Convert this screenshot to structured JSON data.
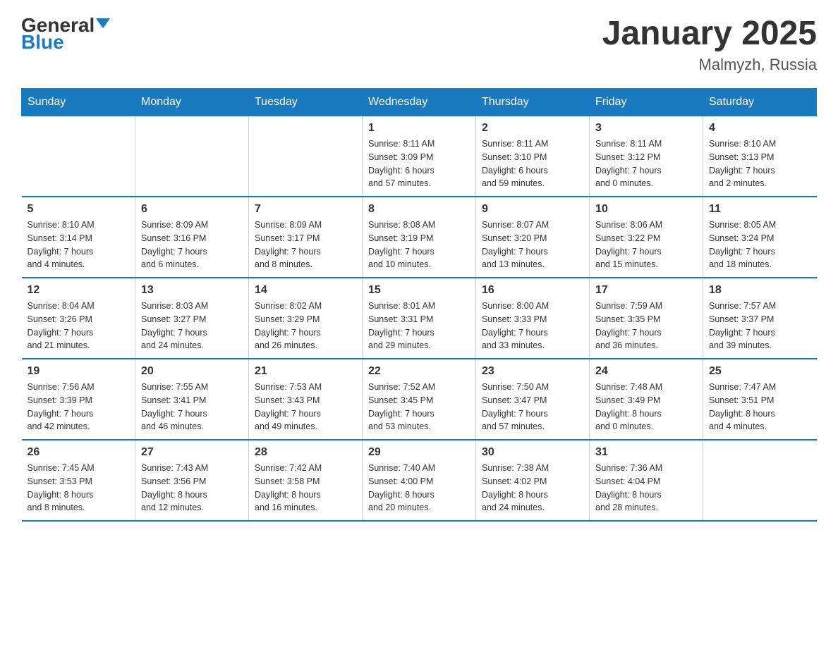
{
  "header": {
    "logo_general": "General",
    "logo_blue": "Blue",
    "month_title": "January 2025",
    "location": "Malmyzh, Russia"
  },
  "days_of_week": [
    "Sunday",
    "Monday",
    "Tuesday",
    "Wednesday",
    "Thursday",
    "Friday",
    "Saturday"
  ],
  "weeks": [
    [
      {
        "day": "",
        "info": ""
      },
      {
        "day": "",
        "info": ""
      },
      {
        "day": "",
        "info": ""
      },
      {
        "day": "1",
        "info": "Sunrise: 8:11 AM\nSunset: 3:09 PM\nDaylight: 6 hours\nand 57 minutes."
      },
      {
        "day": "2",
        "info": "Sunrise: 8:11 AM\nSunset: 3:10 PM\nDaylight: 6 hours\nand 59 minutes."
      },
      {
        "day": "3",
        "info": "Sunrise: 8:11 AM\nSunset: 3:12 PM\nDaylight: 7 hours\nand 0 minutes."
      },
      {
        "day": "4",
        "info": "Sunrise: 8:10 AM\nSunset: 3:13 PM\nDaylight: 7 hours\nand 2 minutes."
      }
    ],
    [
      {
        "day": "5",
        "info": "Sunrise: 8:10 AM\nSunset: 3:14 PM\nDaylight: 7 hours\nand 4 minutes."
      },
      {
        "day": "6",
        "info": "Sunrise: 8:09 AM\nSunset: 3:16 PM\nDaylight: 7 hours\nand 6 minutes."
      },
      {
        "day": "7",
        "info": "Sunrise: 8:09 AM\nSunset: 3:17 PM\nDaylight: 7 hours\nand 8 minutes."
      },
      {
        "day": "8",
        "info": "Sunrise: 8:08 AM\nSunset: 3:19 PM\nDaylight: 7 hours\nand 10 minutes."
      },
      {
        "day": "9",
        "info": "Sunrise: 8:07 AM\nSunset: 3:20 PM\nDaylight: 7 hours\nand 13 minutes."
      },
      {
        "day": "10",
        "info": "Sunrise: 8:06 AM\nSunset: 3:22 PM\nDaylight: 7 hours\nand 15 minutes."
      },
      {
        "day": "11",
        "info": "Sunrise: 8:05 AM\nSunset: 3:24 PM\nDaylight: 7 hours\nand 18 minutes."
      }
    ],
    [
      {
        "day": "12",
        "info": "Sunrise: 8:04 AM\nSunset: 3:26 PM\nDaylight: 7 hours\nand 21 minutes."
      },
      {
        "day": "13",
        "info": "Sunrise: 8:03 AM\nSunset: 3:27 PM\nDaylight: 7 hours\nand 24 minutes."
      },
      {
        "day": "14",
        "info": "Sunrise: 8:02 AM\nSunset: 3:29 PM\nDaylight: 7 hours\nand 26 minutes."
      },
      {
        "day": "15",
        "info": "Sunrise: 8:01 AM\nSunset: 3:31 PM\nDaylight: 7 hours\nand 29 minutes."
      },
      {
        "day": "16",
        "info": "Sunrise: 8:00 AM\nSunset: 3:33 PM\nDaylight: 7 hours\nand 33 minutes."
      },
      {
        "day": "17",
        "info": "Sunrise: 7:59 AM\nSunset: 3:35 PM\nDaylight: 7 hours\nand 36 minutes."
      },
      {
        "day": "18",
        "info": "Sunrise: 7:57 AM\nSunset: 3:37 PM\nDaylight: 7 hours\nand 39 minutes."
      }
    ],
    [
      {
        "day": "19",
        "info": "Sunrise: 7:56 AM\nSunset: 3:39 PM\nDaylight: 7 hours\nand 42 minutes."
      },
      {
        "day": "20",
        "info": "Sunrise: 7:55 AM\nSunset: 3:41 PM\nDaylight: 7 hours\nand 46 minutes."
      },
      {
        "day": "21",
        "info": "Sunrise: 7:53 AM\nSunset: 3:43 PM\nDaylight: 7 hours\nand 49 minutes."
      },
      {
        "day": "22",
        "info": "Sunrise: 7:52 AM\nSunset: 3:45 PM\nDaylight: 7 hours\nand 53 minutes."
      },
      {
        "day": "23",
        "info": "Sunrise: 7:50 AM\nSunset: 3:47 PM\nDaylight: 7 hours\nand 57 minutes."
      },
      {
        "day": "24",
        "info": "Sunrise: 7:48 AM\nSunset: 3:49 PM\nDaylight: 8 hours\nand 0 minutes."
      },
      {
        "day": "25",
        "info": "Sunrise: 7:47 AM\nSunset: 3:51 PM\nDaylight: 8 hours\nand 4 minutes."
      }
    ],
    [
      {
        "day": "26",
        "info": "Sunrise: 7:45 AM\nSunset: 3:53 PM\nDaylight: 8 hours\nand 8 minutes."
      },
      {
        "day": "27",
        "info": "Sunrise: 7:43 AM\nSunset: 3:56 PM\nDaylight: 8 hours\nand 12 minutes."
      },
      {
        "day": "28",
        "info": "Sunrise: 7:42 AM\nSunset: 3:58 PM\nDaylight: 8 hours\nand 16 minutes."
      },
      {
        "day": "29",
        "info": "Sunrise: 7:40 AM\nSunset: 4:00 PM\nDaylight: 8 hours\nand 20 minutes."
      },
      {
        "day": "30",
        "info": "Sunrise: 7:38 AM\nSunset: 4:02 PM\nDaylight: 8 hours\nand 24 minutes."
      },
      {
        "day": "31",
        "info": "Sunrise: 7:36 AM\nSunset: 4:04 PM\nDaylight: 8 hours\nand 28 minutes."
      },
      {
        "day": "",
        "info": ""
      }
    ]
  ]
}
